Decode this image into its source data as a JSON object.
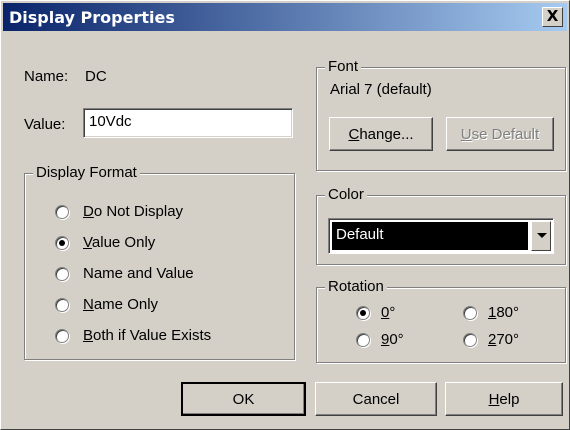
{
  "window": {
    "title": "Display Properties",
    "close_label": "X"
  },
  "name_row": {
    "label": "Name:",
    "value": "DC"
  },
  "value_row": {
    "label": "Value:",
    "value": "10Vdc"
  },
  "display_format": {
    "title": "Display Format",
    "options": [
      {
        "label": "Do Not Display",
        "mnemonic": "D",
        "selected": false
      },
      {
        "label": "Value Only",
        "mnemonic": "V",
        "selected": true
      },
      {
        "label": "Name and Value",
        "mnemonic": "e",
        "selected": false
      },
      {
        "label": "Name Only",
        "mnemonic": "N",
        "selected": false
      },
      {
        "label": "Both if Value Exists",
        "mnemonic": "B",
        "selected": false
      }
    ]
  },
  "font": {
    "title": "Font",
    "current": "Arial 7 (default)",
    "change_button": "Change...",
    "use_default_button": "Use Default",
    "use_default_enabled": false
  },
  "color": {
    "title": "Color",
    "selected": "Default"
  },
  "rotation": {
    "title": "Rotation",
    "options": [
      {
        "label": "0°",
        "selected": true
      },
      {
        "label": "180°",
        "selected": false
      },
      {
        "label": "90°",
        "selected": false
      },
      {
        "label": "270°",
        "selected": false
      }
    ]
  },
  "buttons": {
    "ok": "OK",
    "cancel": "Cancel",
    "help": "Help"
  },
  "colors": {
    "face": "#d4d0c8",
    "title_start": "#0a246a",
    "title_end": "#a6caf0"
  }
}
